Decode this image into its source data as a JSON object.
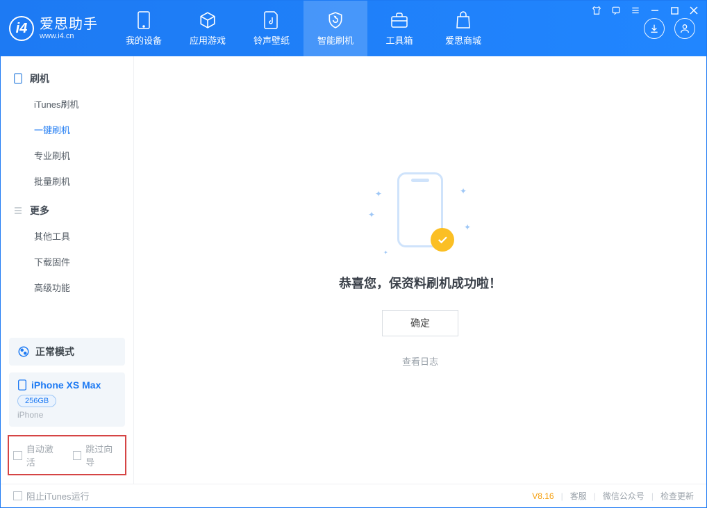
{
  "app": {
    "title": "爱思助手",
    "url": "www.i4.cn"
  },
  "tabs": {
    "device": "我的设备",
    "apps": "应用游戏",
    "ringtone": "铃声壁纸",
    "flash": "智能刷机",
    "toolbox": "工具箱",
    "store": "爱思商城"
  },
  "sidebar": {
    "section_flash": "刷机",
    "items_flash": {
      "itunes": "iTunes刷机",
      "oneclick": "一键刷机",
      "pro": "专业刷机",
      "batch": "批量刷机"
    },
    "section_more": "更多",
    "items_more": {
      "other": "其他工具",
      "firmware": "下载固件",
      "advanced": "高级功能"
    }
  },
  "mode": {
    "label": "正常模式"
  },
  "device": {
    "name": "iPhone XS Max",
    "storage": "256GB",
    "type": "iPhone"
  },
  "opts": {
    "auto_activate": "自动激活",
    "skip_guide": "跳过向导"
  },
  "main": {
    "message": "恭喜您，保资料刷机成功啦！",
    "ok": "确定",
    "log": "查看日志"
  },
  "footer": {
    "block_itunes": "阻止iTunes运行",
    "version": "V8.16",
    "support": "客服",
    "wechat": "微信公众号",
    "update": "检查更新"
  }
}
